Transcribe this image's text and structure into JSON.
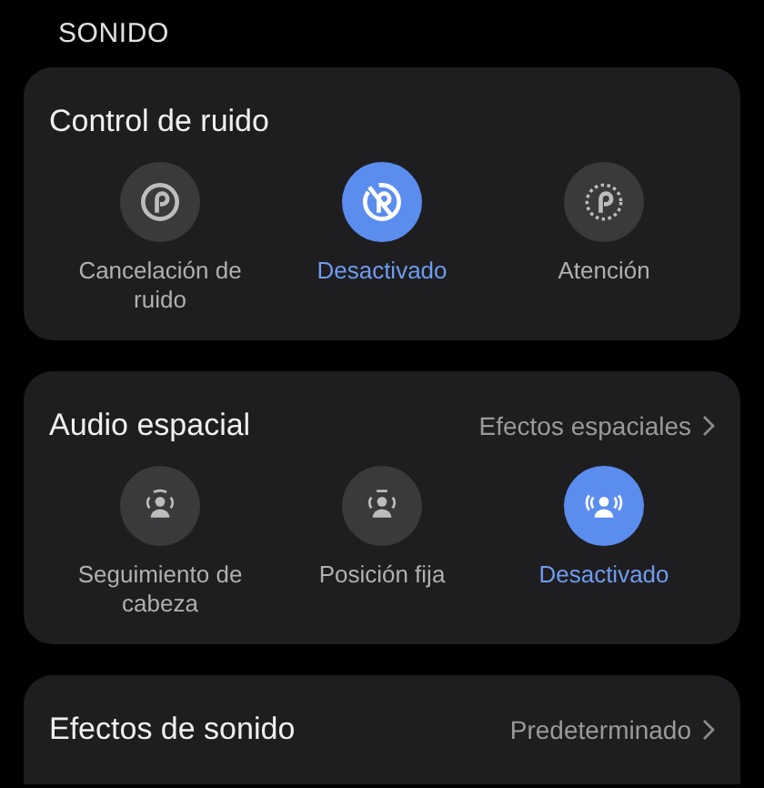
{
  "section_title": "SONIDO",
  "cards": [
    {
      "title": "Control de ruido",
      "options": [
        {
          "label": "Cancelación de ruido",
          "kind": "anc",
          "selected": false
        },
        {
          "label": "Desactivado",
          "kind": "off",
          "selected": true
        },
        {
          "label": "Atención",
          "kind": "aware",
          "selected": false
        }
      ]
    },
    {
      "title": "Audio espacial",
      "link": "Efectos espaciales",
      "options": [
        {
          "label": "Seguimiento de cabeza",
          "kind": "head",
          "selected": false
        },
        {
          "label": "Posición fija",
          "kind": "fixed",
          "selected": false
        },
        {
          "label": "Desactivado",
          "kind": "person",
          "selected": true
        }
      ]
    },
    {
      "title": "Efectos de sonido",
      "link": "Predeterminado"
    }
  ]
}
